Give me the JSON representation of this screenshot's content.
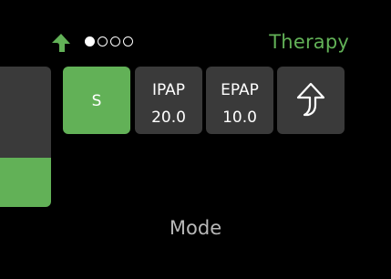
{
  "header": {
    "title": "Therapy",
    "page_indicator": {
      "total": 4,
      "current": 1
    }
  },
  "tiles": {
    "mode": {
      "label": "S",
      "selected": true
    },
    "ipap": {
      "label": "IPAP",
      "value": "20.0"
    },
    "epap": {
      "label": "EPAP",
      "value": "10.0"
    },
    "back": {
      "icon": "back-arrow-icon"
    }
  },
  "footer": {
    "label": "Mode"
  },
  "colors": {
    "accent": "#62b157",
    "tile": "#3a3a3a",
    "background": "#000000",
    "text": "#ffffff",
    "muted_text": "#b8b8b8"
  }
}
